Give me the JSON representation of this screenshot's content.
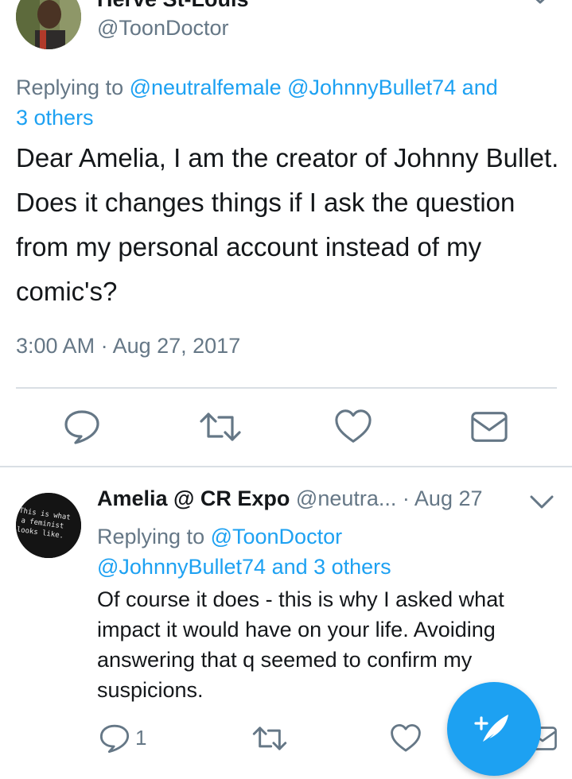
{
  "main_tweet": {
    "author_name": "Herve St-Louis",
    "handle": "@ToonDoctor",
    "replying_prefix": "Replying to ",
    "replying_handle_1": "@neutralfemale",
    "replying_handle_2": "@JohnnyBullet74",
    "replying_and": " and",
    "replying_others": "3 others",
    "text": "Dear Amelia, I am the creator of Johnny Bullet. Does it changes things if I ask the question from my personal account instead of my comic's?",
    "timestamp": "3:00 AM · Aug 27, 2017",
    "actions": {
      "reply_icon": "speech-bubble-icon",
      "retweet_icon": "retweet-icon",
      "like_icon": "heart-icon",
      "share_icon": "envelope-icon"
    }
  },
  "reply_tweet": {
    "author_name": "Amelia @ CR Expo",
    "handle": "@neutra...",
    "separator": "·",
    "date": "Aug 27",
    "replying_prefix": "Replying to ",
    "replying_handle_1": "@ToonDoctor",
    "replying_handle_2": "@JohnnyBullet74",
    "replying_others": "and 3 others",
    "text": "Of course it does - this is why I asked what impact it would have on your life. Avoiding answering that q seemed to confirm my suspicions.",
    "avatar_text": "This is what a feminist looks like",
    "reply_count": "1"
  },
  "colors": {
    "link": "#1da1f2",
    "secondary_text": "#657786",
    "primary_text": "#14171a",
    "divider": "#d9dfe4",
    "fab": "#1da1f2"
  }
}
